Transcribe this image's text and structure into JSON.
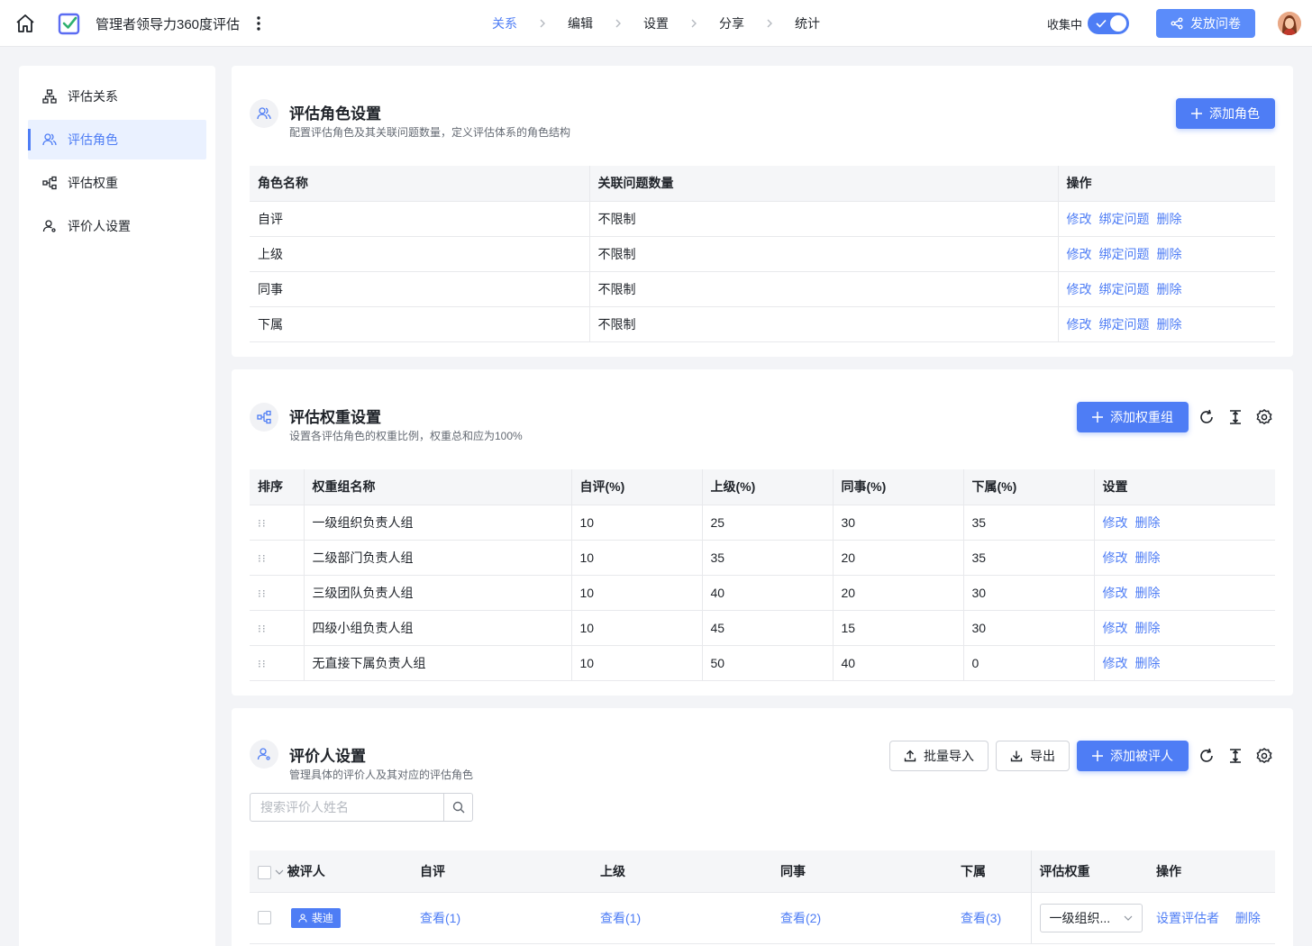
{
  "header": {
    "title": "管理者领导力360度评估",
    "steps": [
      "关系",
      "编辑",
      "设置",
      "分享",
      "统计"
    ],
    "active_step": 0,
    "status_label": "收集中",
    "collecting_on": true,
    "publish_label": "发放问卷"
  },
  "sidebar": {
    "items": [
      {
        "label": "评估关系",
        "icon": "hierarchy-icon"
      },
      {
        "label": "评估角色",
        "icon": "users-icon",
        "active": true
      },
      {
        "label": "评估权重",
        "icon": "weight-tree-icon"
      },
      {
        "label": "评价人设置",
        "icon": "user-settings-icon"
      }
    ]
  },
  "roles": {
    "title": "评估角色设置",
    "subtitle": "配置评估角色及其关联问题数量，定义评估体系的角色结构",
    "add_label": "添加角色",
    "columns": [
      "角色名称",
      "关联问题数量",
      "操作"
    ],
    "rows": [
      {
        "name": "自评",
        "count": "不限制"
      },
      {
        "name": "上级",
        "count": "不限制"
      },
      {
        "name": "同事",
        "count": "不限制"
      },
      {
        "name": "下属",
        "count": "不限制"
      }
    ],
    "actions": [
      "修改",
      "绑定问题",
      "删除"
    ]
  },
  "weights": {
    "title": "评估权重设置",
    "subtitle": "设置各评估角色的权重比例，权重总和应为100%",
    "add_label": "添加权重组",
    "columns": [
      "排序",
      "权重组名称",
      "自评(%)",
      "上级(%)",
      "同事(%)",
      "下属(%)",
      "设置"
    ],
    "rows": [
      {
        "name": "一级组织负责人组",
        "self": "10",
        "superior": "25",
        "peer": "30",
        "sub": "35"
      },
      {
        "name": "二级部门负责人组",
        "self": "10",
        "superior": "35",
        "peer": "20",
        "sub": "35"
      },
      {
        "name": "三级团队负责人组",
        "self": "10",
        "superior": "40",
        "peer": "20",
        "sub": "30"
      },
      {
        "name": "四级小组负责人组",
        "self": "10",
        "superior": "45",
        "peer": "15",
        "sub": "30"
      },
      {
        "name": "无直接下属负责人组",
        "self": "10",
        "superior": "50",
        "peer": "40",
        "sub": "0"
      }
    ],
    "actions": [
      "修改",
      "删除"
    ]
  },
  "evaluators": {
    "title": "评价人设置",
    "subtitle": "管理具体的评价人及其对应的评估角色",
    "import_label": "批量导入",
    "export_label": "导出",
    "add_label": "添加被评人",
    "search_placeholder": "搜索评价人姓名",
    "columns": [
      "被评人",
      "自评",
      "上级",
      "同事",
      "下属",
      "评估权重",
      "操作"
    ],
    "rows": [
      {
        "name": "裴迪",
        "self": "查看(1)",
        "superior": "查看(1)",
        "peer": "查看(2)",
        "sub": "查看(3)",
        "weight": "一级组织...",
        "set_label": "设置评估者",
        "delete_label": "删除"
      }
    ]
  },
  "colors": {
    "accent": "#4e7df5",
    "background": "#f3f4f7"
  }
}
